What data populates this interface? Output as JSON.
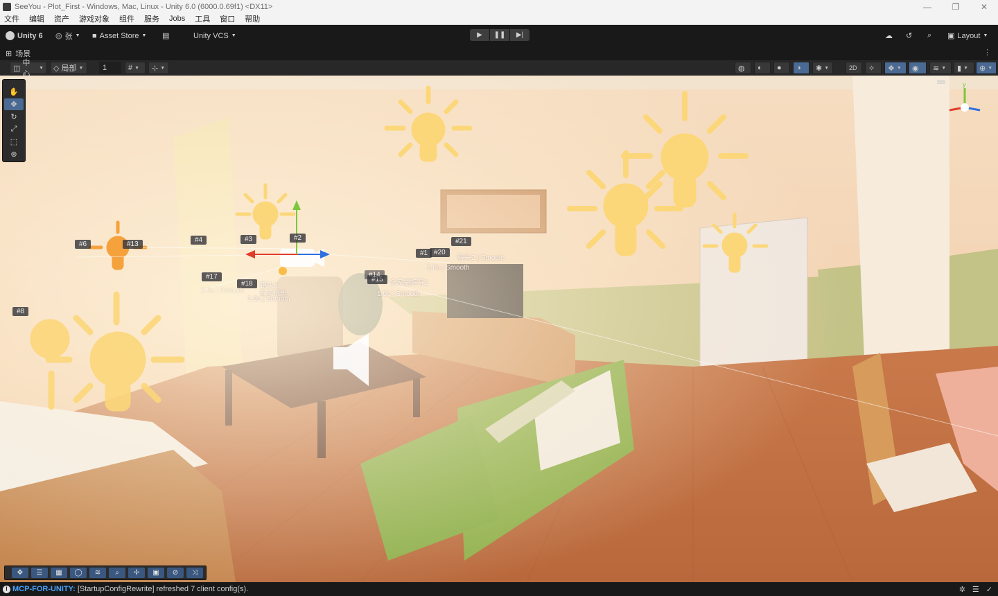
{
  "window": {
    "title": "SeeYou - Plot_First - Windows, Mac, Linux - Unity 6.0 (6000.0.69f1) <DX11>",
    "controls": {
      "minimize": "—",
      "maximize": "❐",
      "close": "✕"
    }
  },
  "menu": [
    "文件",
    "编辑",
    "资产",
    "游戏对象",
    "组件",
    "服务",
    "Jobs",
    "工具",
    "窗口",
    "帮助"
  ],
  "toolbar": {
    "unity_label": "Unity 6",
    "account_label": "张",
    "asset_store_label": "Asset Store",
    "vcs_label": "Unity VCS",
    "layout_label": "Layout",
    "play": "▶",
    "pause": "❚❚",
    "step": "▶|"
  },
  "scene_tab": {
    "label": "场景",
    "menu": "⋮"
  },
  "scene_toolbar": {
    "pivot_label": "中心",
    "space_label": "局部",
    "grid_snap_value": "1"
  },
  "overlay_tags": [
    {
      "text": "#6"
    },
    {
      "text": "#13"
    },
    {
      "text": "#4"
    },
    {
      "text": "#3"
    },
    {
      "text": "#2"
    },
    {
      "text": "#17"
    },
    {
      "text": "#18"
    },
    {
      "text": "#8"
    },
    {
      "text": "#15"
    },
    {
      "text": "#14"
    },
    {
      "text": "#1"
    },
    {
      "text": "#20"
    },
    {
      "text": "#21"
    }
  ],
  "overlay_annotations": [
    {
      "text": "转头2 | Smooth"
    },
    {
      "text": "1.0s | Smooth"
    },
    {
      "text": "全家福特写1"
    },
    {
      "text": "1.0s | Smooth"
    },
    {
      "text": "镜头2"
    },
    {
      "text": "玄关镜头"
    },
    {
      "text": "1.0s | Smooth"
    },
    {
      "text": "2.5s | Smooth"
    }
  ],
  "status": {
    "source": "MCP-FOR-UNITY:",
    "message": "[StartupConfigRewrite] refreshed 7 client config(s)."
  },
  "colors": {
    "accent": "#4a6a94",
    "bulb": "#fcd77a",
    "status_source": "#4aa3ff"
  }
}
